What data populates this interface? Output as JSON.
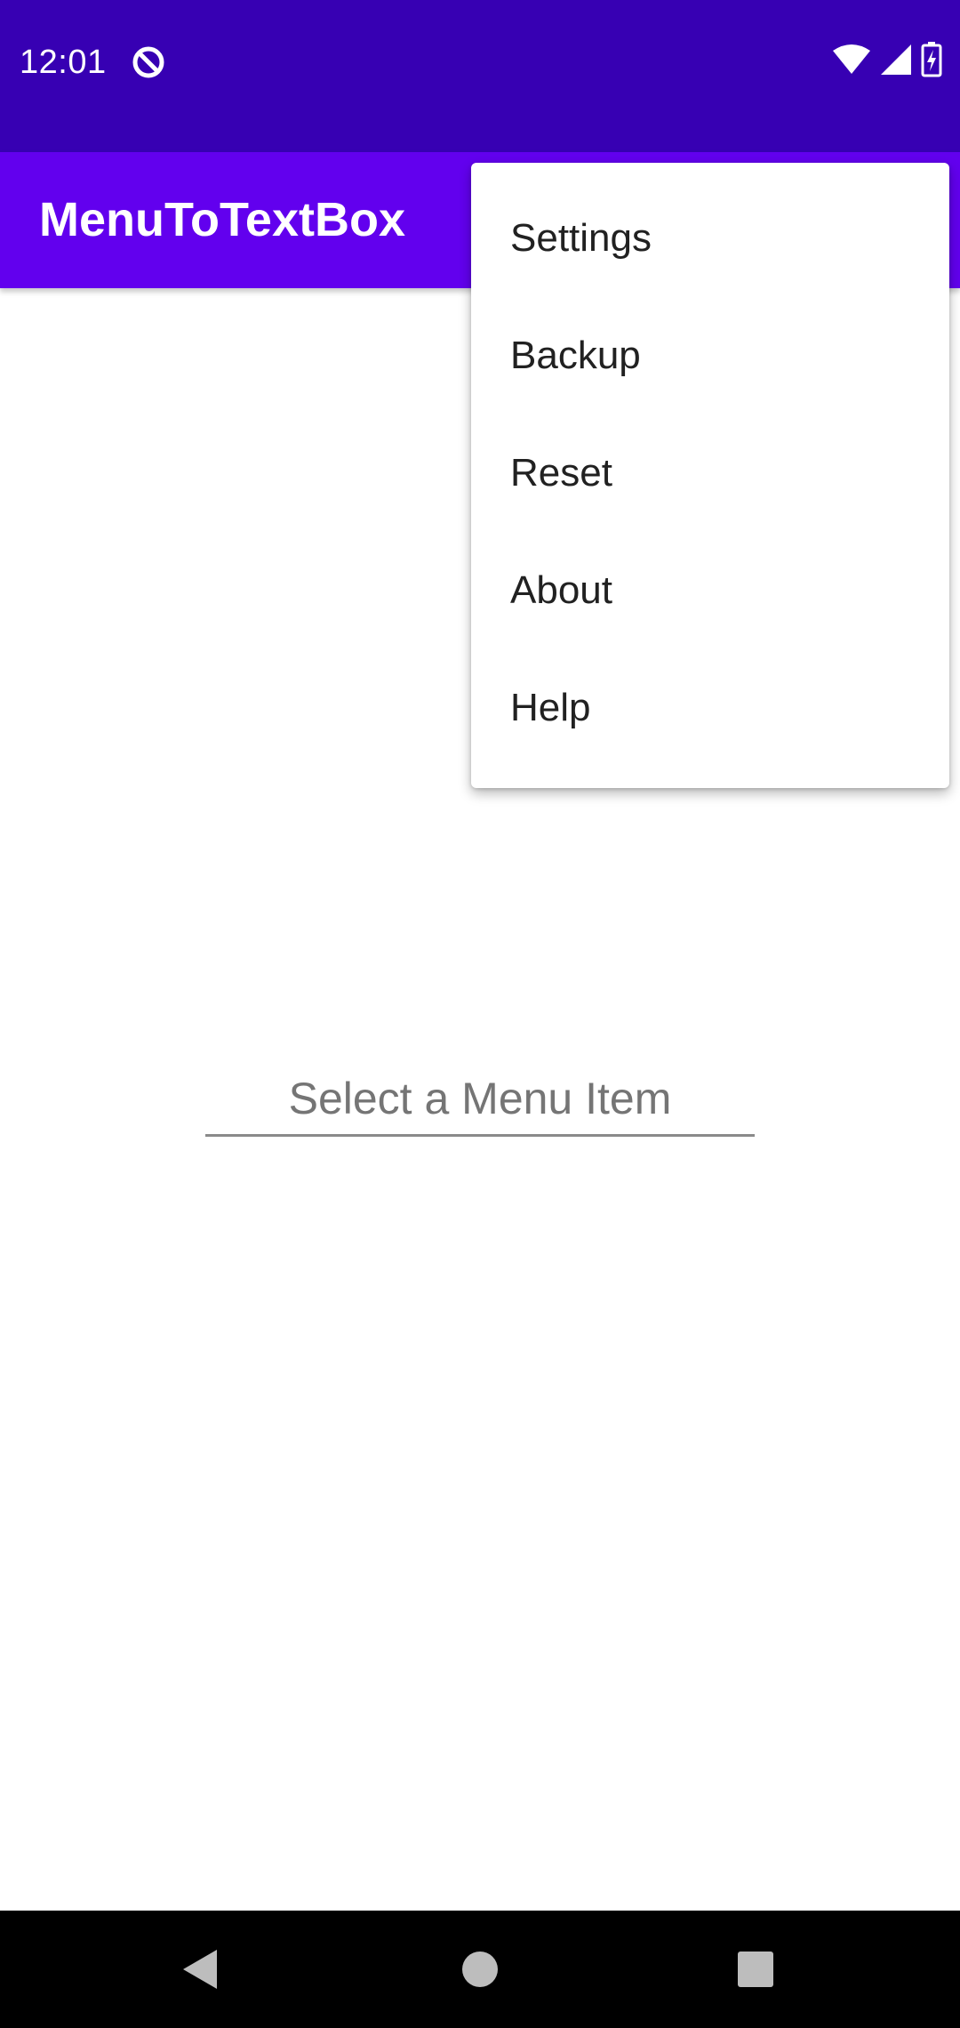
{
  "status_bar": {
    "time": "12:01",
    "app_icon": "circle-slash-icon",
    "wifi_icon": "wifi-icon",
    "signal_icon": "cellular-signal-icon",
    "battery_icon": "battery-charging-icon",
    "background": "#3700b3"
  },
  "app_bar": {
    "title": "MenuToTextBox",
    "background": "#6200ee"
  },
  "overflow_menu": {
    "items": [
      {
        "label": "Settings"
      },
      {
        "label": "Backup"
      },
      {
        "label": "Reset"
      },
      {
        "label": "About"
      },
      {
        "label": "Help"
      }
    ]
  },
  "main": {
    "text_field": {
      "value": "",
      "placeholder": "Select a Menu Item"
    }
  },
  "nav_bar": {
    "back_icon": "back-triangle-icon",
    "home_icon": "home-circle-icon",
    "recents_icon": "recents-square-icon"
  }
}
